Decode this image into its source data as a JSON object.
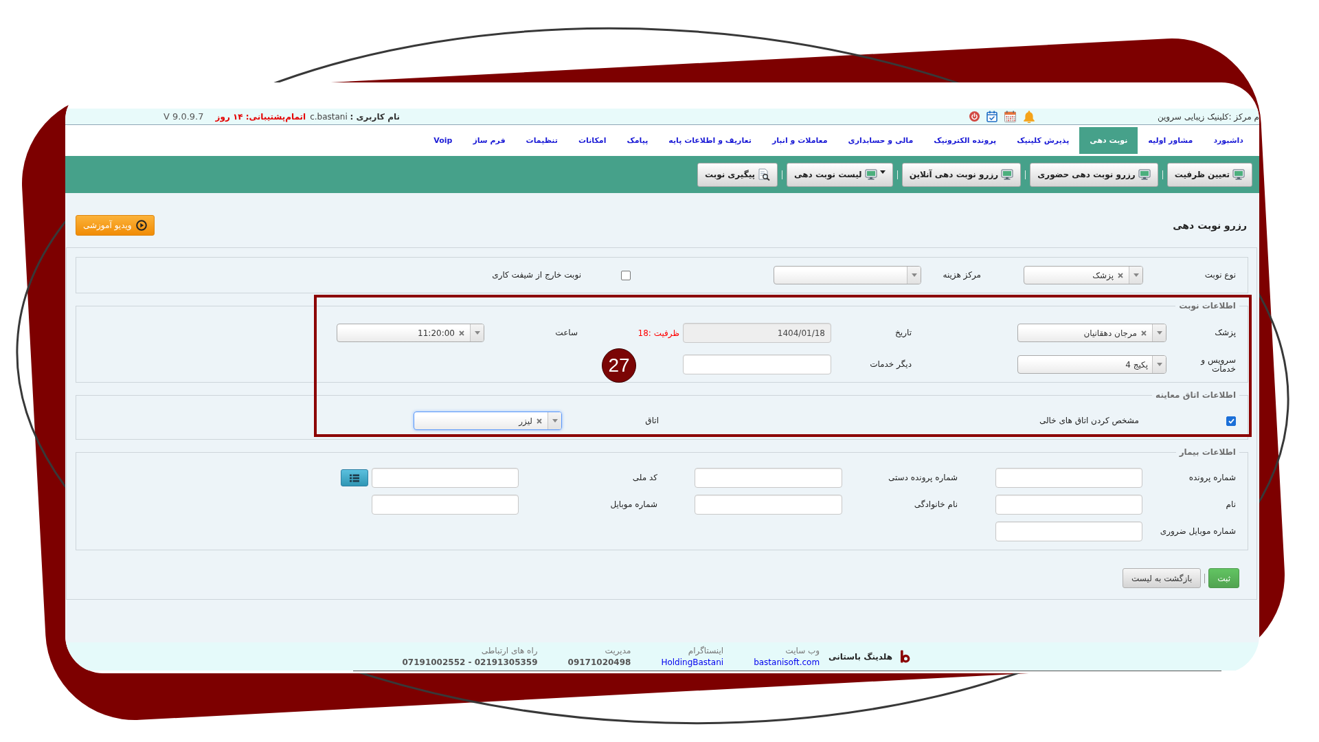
{
  "top_bar": {
    "center_name": "م مرکز :کلینیک زیبایی سروین",
    "user": "**نام کاربری :** c.bastani",
    "support": "اتمام‌پشتیبانی: ۱۴ روز",
    "version": "V 9.0.9.7"
  },
  "nav_tabs": [
    {
      "label": "داشبورد",
      "selected": false
    },
    {
      "label": "مشاور اولیه",
      "selected": false
    },
    {
      "label": "نوبت دهی",
      "selected": true
    },
    {
      "label": "پذیرش کلینیک",
      "selected": false
    },
    {
      "label": "پرونده الکترونیک",
      "selected": false
    },
    {
      "label": "مالی و حسابداری",
      "selected": false
    },
    {
      "label": "معاملات و انبار",
      "selected": false
    },
    {
      "label": "تعاریف و اطلاعات پایه",
      "selected": false
    },
    {
      "label": "پیامک",
      "selected": false
    },
    {
      "label": "امکانات",
      "selected": false
    },
    {
      "label": "تنظیمات",
      "selected": false
    },
    {
      "label": "فرم ساز",
      "selected": false
    },
    {
      "label": "Voip",
      "selected": false
    }
  ],
  "toolbar": [
    {
      "label": "تعیین ظرفیت",
      "kind": "page",
      "dropdown": false
    },
    {
      "label": "رزرو نوبت دهی حضوری",
      "kind": "page",
      "dropdown": false
    },
    {
      "label": "رزرو نوبت دهی آنلاین",
      "kind": "page",
      "dropdown": false
    },
    {
      "label": "لیست نوبت دهی",
      "kind": "page",
      "dropdown": true
    },
    {
      "label": "پیگیری نوبت",
      "kind": "search",
      "dropdown": false
    }
  ],
  "page_title": "رزرو نوبت دهی",
  "video_button": {
    "label": "ویدیو آموزشی"
  },
  "form": {
    "sections": [
      {
        "rows": [
          [
            {
              "kind": "label",
              "text": "نوع نوبت"
            },
            {
              "kind": "select",
              "value": "پزشک",
              "clear_button": true,
              "focused": false
            },
            {
              "kind": "label",
              "text": "مرکز هزینه"
            },
            {
              "kind": "select",
              "focused": false
            },
            {
              "kind": "checkbox",
              "checked": false
            },
            {
              "kind": "label",
              "text": "نوبت خارج از شیفت کاری"
            }
          ]
        ]
      },
      {
        "legend": "اطلاعات نوبت",
        "rows": [
          [
            {
              "kind": "label",
              "text": "پزشک"
            },
            {
              "kind": "select",
              "value": "مرجان دهقانیان",
              "clear_button": true,
              "focused": false
            },
            {
              "kind": "label",
              "text": "تاریخ"
            },
            {
              "kind": "input",
              "value": "1404/01/18",
              "disabled": true
            },
            {
              "kind": "note",
              "text": "ظرفیت :18"
            },
            {
              "kind": "label",
              "text": "ساعت"
            },
            {
              "kind": "select",
              "value": "11:20:00",
              "clear_button": true,
              "focused": false
            }
          ],
          [
            {
              "kind": "label",
              "text": "سرویس و خدمات"
            },
            {
              "kind": "select",
              "value": "پکیج 4",
              "clear_button": false,
              "focused": false
            },
            {
              "kind": "label",
              "text": "دیگر خدمات"
            },
            {
              "kind": "input",
              "disabled": false
            }
          ]
        ]
      },
      {
        "legend": "اطلاعات اتاق معاینه",
        "rows": [
          [
            {
              "kind": "checkbox",
              "checked": true
            },
            {
              "kind": "label",
              "text": "مشخص کردن اتاق های خالی"
            },
            {
              "kind": "label",
              "text": "اتاق"
            },
            {
              "kind": "select",
              "value": "لیزر",
              "clear_button": true,
              "focused": true
            }
          ]
        ]
      },
      {
        "legend": "اطلاعات بیمار",
        "rows": [
          [
            {
              "kind": "label",
              "text": "شماره پرونده"
            },
            {
              "kind": "input",
              "disabled": false
            },
            {
              "kind": "label",
              "text": "شماره پرونده دستی"
            },
            {
              "kind": "input",
              "disabled": false
            },
            {
              "kind": "label",
              "text": "کد ملی"
            },
            {
              "kind": "input",
              "disabled": false
            },
            {
              "kind": "icon_button"
            }
          ],
          [
            {
              "kind": "label",
              "text": "نام"
            },
            {
              "kind": "input",
              "disabled": false
            },
            {
              "kind": "label",
              "text": "نام خانوادگی"
            },
            {
              "kind": "input",
              "disabled": false
            },
            {
              "kind": "label",
              "text": "شماره موبایل"
            },
            {
              "kind": "input",
              "disabled": false
            }
          ],
          [
            {
              "kind": "label",
              "text": "شماره موبایل ضروری"
            },
            {
              "kind": "input",
              "disabled": false
            }
          ]
        ]
      }
    ]
  },
  "actions": [
    {
      "label": "ثبت",
      "kind": "primary"
    },
    {
      "label": "بازگشت به لیست",
      "kind": "secondary"
    }
  ],
  "annotation": {
    "step": "27"
  },
  "footer": {
    "company": "هلدینگ باستانی",
    "contacts": [
      {
        "label": "وب سایت",
        "value": "bastanisoft.com",
        "link": true
      },
      {
        "label": "اینستاگرام",
        "value": "HoldingBastani",
        "link": true
      },
      {
        "label": "مدیریت",
        "value": "09171020498",
        "link": false
      },
      {
        "label": "راه های ارتباطی",
        "value": "07191002552 - 02191305359",
        "link": false
      }
    ]
  }
}
